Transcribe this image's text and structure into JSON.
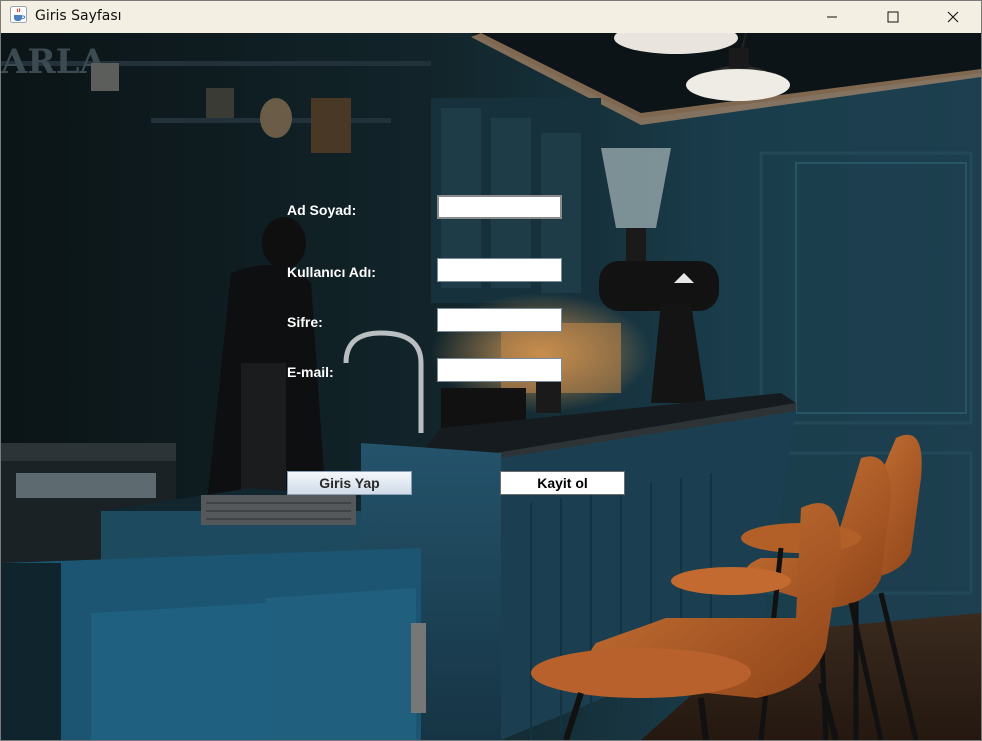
{
  "window": {
    "title": "Giris Sayfası",
    "icon": "java-cup-icon",
    "controls": [
      "minimize-icon",
      "maximize-icon",
      "close-icon"
    ]
  },
  "form": {
    "ad_soyad_label": "Ad Soyad:",
    "kullanici_adi_label": "Kullanıcı Adı:",
    "sifre_label": "Sifre:",
    "email_label": "E-mail:",
    "ad_soyad_value": "",
    "kullanici_adi_value": "",
    "sifre_value": "",
    "email_value": ""
  },
  "buttons": {
    "giris_label": "Giris Yap",
    "kayit_label": "Kayit ol"
  },
  "colors": {
    "titlebar": "#f3efe2",
    "label_text": "#ffffff",
    "scene_dark": "#0f1a1d",
    "scene_teal": "#1f4a5c",
    "chair_leather": "#b8612c"
  }
}
